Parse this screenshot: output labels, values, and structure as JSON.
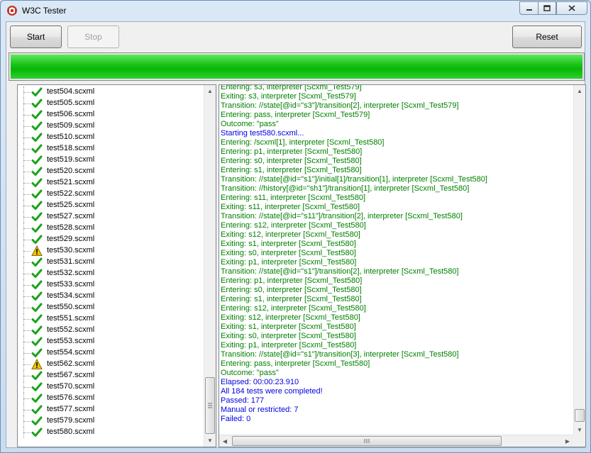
{
  "window": {
    "title": "W3C Tester"
  },
  "toolbar": {
    "start_label": "Start",
    "stop_label": "Stop",
    "reset_label": "Reset"
  },
  "progress": {
    "value_percent": 100,
    "color": "#16c216"
  },
  "colors": {
    "log_green": "#008000",
    "log_blue": "#0000e0",
    "pass": "#1aa21a",
    "warn": "#f2c200"
  },
  "tests": [
    {
      "name": "test504.scxml",
      "status": "pass"
    },
    {
      "name": "test505.scxml",
      "status": "pass"
    },
    {
      "name": "test506.scxml",
      "status": "pass"
    },
    {
      "name": "test509.scxml",
      "status": "pass"
    },
    {
      "name": "test510.scxml",
      "status": "pass"
    },
    {
      "name": "test518.scxml",
      "status": "pass"
    },
    {
      "name": "test519.scxml",
      "status": "pass"
    },
    {
      "name": "test520.scxml",
      "status": "pass"
    },
    {
      "name": "test521.scxml",
      "status": "pass"
    },
    {
      "name": "test522.scxml",
      "status": "pass"
    },
    {
      "name": "test525.scxml",
      "status": "pass"
    },
    {
      "name": "test527.scxml",
      "status": "pass"
    },
    {
      "name": "test528.scxml",
      "status": "pass"
    },
    {
      "name": "test529.scxml",
      "status": "pass"
    },
    {
      "name": "test530.scxml",
      "status": "warning"
    },
    {
      "name": "test531.scxml",
      "status": "pass"
    },
    {
      "name": "test532.scxml",
      "status": "pass"
    },
    {
      "name": "test533.scxml",
      "status": "pass"
    },
    {
      "name": "test534.scxml",
      "status": "pass"
    },
    {
      "name": "test550.scxml",
      "status": "pass"
    },
    {
      "name": "test551.scxml",
      "status": "pass"
    },
    {
      "name": "test552.scxml",
      "status": "pass"
    },
    {
      "name": "test553.scxml",
      "status": "pass"
    },
    {
      "name": "test554.scxml",
      "status": "pass"
    },
    {
      "name": "test562.scxml",
      "status": "warning"
    },
    {
      "name": "test567.scxml",
      "status": "pass"
    },
    {
      "name": "test570.scxml",
      "status": "pass"
    },
    {
      "name": "test576.scxml",
      "status": "pass"
    },
    {
      "name": "test577.scxml",
      "status": "pass"
    },
    {
      "name": "test579.scxml",
      "status": "pass"
    },
    {
      "name": "test580.scxml",
      "status": "pass"
    }
  ],
  "log": [
    {
      "text": "Entering: s3, interpreter [Scxml_Test579]",
      "kind": "green"
    },
    {
      "text": "Exiting: s3, interpreter [Scxml_Test579]",
      "kind": "green"
    },
    {
      "text": "Transition: //state[@id=\"s3\"]/transition[2], interpreter [Scxml_Test579]",
      "kind": "green"
    },
    {
      "text": "Entering: pass, interpreter [Scxml_Test579]",
      "kind": "green"
    },
    {
      "text": "Outcome: \"pass\"",
      "kind": "green"
    },
    {
      "text": "Starting test580.scxml...",
      "kind": "blue"
    },
    {
      "text": "Entering: /scxml[1], interpreter [Scxml_Test580]",
      "kind": "green"
    },
    {
      "text": "Entering: p1, interpreter [Scxml_Test580]",
      "kind": "green"
    },
    {
      "text": "Entering: s0, interpreter [Scxml_Test580]",
      "kind": "green"
    },
    {
      "text": "Entering: s1, interpreter [Scxml_Test580]",
      "kind": "green"
    },
    {
      "text": "Transition: //state[@id=\"s1\"]/initial[1]/transition[1], interpreter [Scxml_Test580]",
      "kind": "green"
    },
    {
      "text": "Transition: //history[@id=\"sh1\"]/transition[1], interpreter [Scxml_Test580]",
      "kind": "green"
    },
    {
      "text": "Entering: s11, interpreter [Scxml_Test580]",
      "kind": "green"
    },
    {
      "text": "Exiting: s11, interpreter [Scxml_Test580]",
      "kind": "green"
    },
    {
      "text": "Transition: //state[@id=\"s11\"]/transition[2], interpreter [Scxml_Test580]",
      "kind": "green"
    },
    {
      "text": "Entering: s12, interpreter [Scxml_Test580]",
      "kind": "green"
    },
    {
      "text": "Exiting: s12, interpreter [Scxml_Test580]",
      "kind": "green"
    },
    {
      "text": "Exiting: s1, interpreter [Scxml_Test580]",
      "kind": "green"
    },
    {
      "text": "Exiting: s0, interpreter [Scxml_Test580]",
      "kind": "green"
    },
    {
      "text": "Exiting: p1, interpreter [Scxml_Test580]",
      "kind": "green"
    },
    {
      "text": "Transition: //state[@id=\"s1\"]/transition[2], interpreter [Scxml_Test580]",
      "kind": "green"
    },
    {
      "text": "Entering: p1, interpreter [Scxml_Test580]",
      "kind": "green"
    },
    {
      "text": "Entering: s0, interpreter [Scxml_Test580]",
      "kind": "green"
    },
    {
      "text": "Entering: s1, interpreter [Scxml_Test580]",
      "kind": "green"
    },
    {
      "text": "Entering: s12, interpreter [Scxml_Test580]",
      "kind": "green"
    },
    {
      "text": "Exiting: s12, interpreter [Scxml_Test580]",
      "kind": "green"
    },
    {
      "text": "Exiting: s1, interpreter [Scxml_Test580]",
      "kind": "green"
    },
    {
      "text": "Exiting: s0, interpreter [Scxml_Test580]",
      "kind": "green"
    },
    {
      "text": "Exiting: p1, interpreter [Scxml_Test580]",
      "kind": "green"
    },
    {
      "text": "Transition: //state[@id=\"s1\"]/transition[3], interpreter [Scxml_Test580]",
      "kind": "green"
    },
    {
      "text": "Entering: pass, interpreter [Scxml_Test580]",
      "kind": "green"
    },
    {
      "text": "Outcome: \"pass\"",
      "kind": "green"
    },
    {
      "text": "Elapsed: 00:00:23.910",
      "kind": "blue"
    },
    {
      "text": "All 184 tests were completed!",
      "kind": "blue"
    },
    {
      "text": "Passed: 177",
      "kind": "blue"
    },
    {
      "text": "Manual or restricted: 7",
      "kind": "blue"
    },
    {
      "text": "Failed: 0",
      "kind": "blue"
    }
  ]
}
